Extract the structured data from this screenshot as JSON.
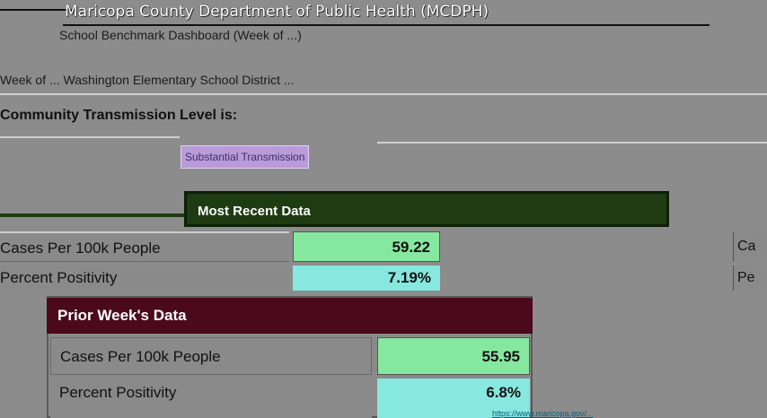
{
  "header": {
    "title": "Maricopa County Department of Public Health (MCDPH)",
    "subtitle": "School Benchmark Dashboard (Week of ...)"
  },
  "week_line": "Week of ... Washington Elementary School District ...",
  "community": {
    "label": "Community Transmission Level is:",
    "level": "Substantial Transmission",
    "level_color": "#b99bd9"
  },
  "current_week": {
    "heading": "Most Recent Data",
    "rows": [
      {
        "label": "Cases Per 100k People",
        "value": "59.22"
      },
      {
        "label": "Percent Positivity",
        "value": "7.19%"
      }
    ]
  },
  "right_col": {
    "row1": "Ca",
    "row2": "Pe"
  },
  "prior_week": {
    "heading": "Prior Week's Data",
    "heading_color": "#4a0a1c",
    "rows": [
      {
        "label": "Cases Per 100k People",
        "value": "55.95"
      },
      {
        "label": "Percent Positivity",
        "value": "6.8%"
      }
    ]
  },
  "footer_link": "https://www.maricopa.gov/...",
  "colors": {
    "cases_green": "#86e89f",
    "positivity_teal": "#86e8df",
    "current_head": "#1e3b12"
  }
}
